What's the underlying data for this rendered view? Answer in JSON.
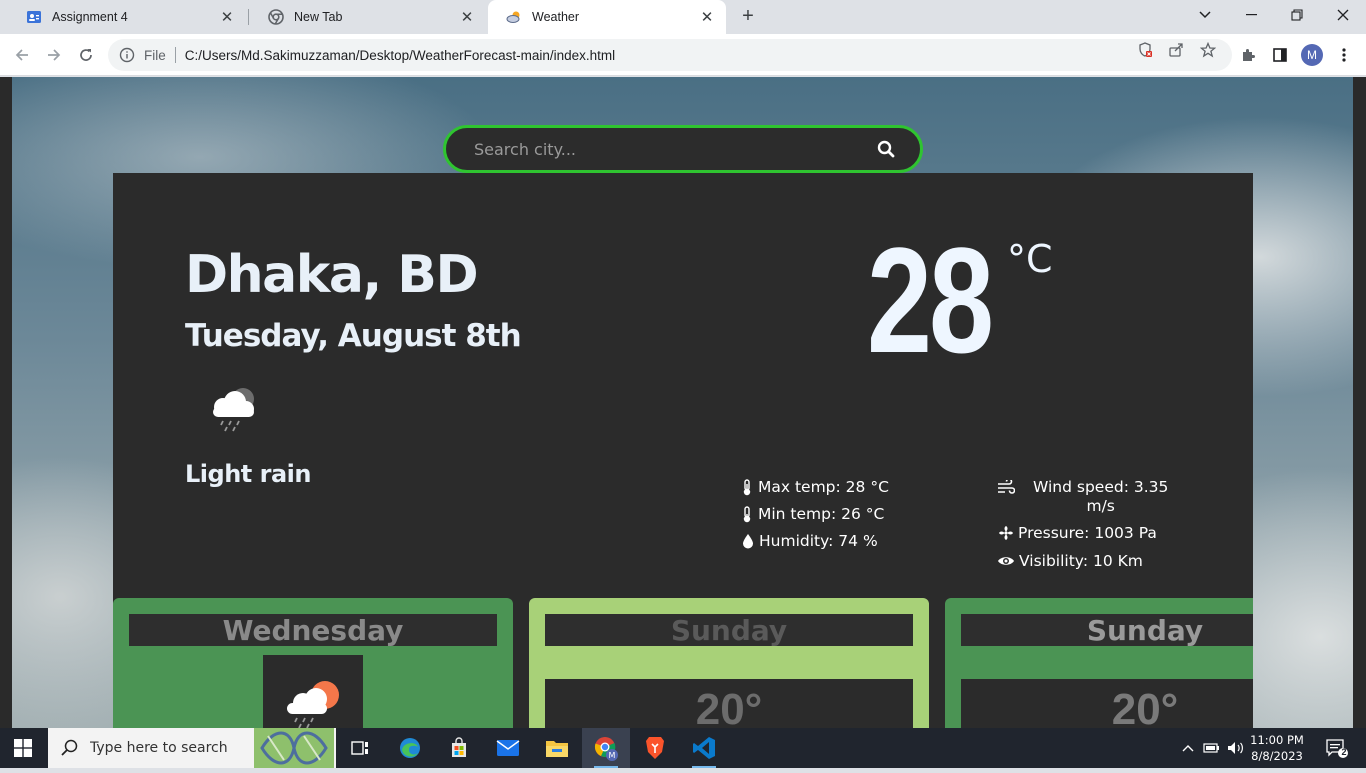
{
  "browser": {
    "tabs": [
      {
        "title": "Assignment 4",
        "icon": "person-doc-icon"
      },
      {
        "title": "New Tab",
        "icon": "chrome-icon"
      },
      {
        "title": "Weather",
        "icon": "weather-cloud-icon",
        "active": true
      }
    ],
    "address": {
      "scheme": "File",
      "url": "C:/Users/Md.Sakimuzzaman/Desktop/WeatherForecast-main/index.html"
    },
    "profile_initial": "M"
  },
  "page": {
    "search": {
      "placeholder": "Search city..."
    },
    "current": {
      "city": "Dhaka, BD",
      "date": "Tuesday, August 8th",
      "condition": "Light rain",
      "temperature": "28",
      "unit": "°C",
      "stats_left": [
        {
          "icon": "thermometer-icon",
          "text": "Max temp: 28 °C"
        },
        {
          "icon": "thermometer-icon",
          "text": "Min temp: 26 °C"
        },
        {
          "icon": "droplet-icon",
          "text": "Humidity: 74 %"
        }
      ],
      "stats_right": [
        {
          "icon": "wind-icon",
          "text_line1": "Wind speed: 3.35",
          "text_line2": "m/s"
        },
        {
          "icon": "fan-icon",
          "text": "Pressure: 1003 Pa"
        },
        {
          "icon": "eye-icon",
          "text": "Visibility: 10 Km"
        }
      ]
    },
    "forecast": [
      {
        "day": "Wednesday",
        "temp": "",
        "bg": "#4b9454"
      },
      {
        "day": "Sunday",
        "temp": "20°",
        "bg": "#a8d178"
      },
      {
        "day": "Sunday",
        "temp": "20°",
        "bg": "#4b9454"
      }
    ],
    "colors": {
      "search_border": "#2fc430",
      "card_bg": "#2b2b2b"
    }
  },
  "taskbar": {
    "search_placeholder": "Type here to search",
    "time": "11:00 PM",
    "date": "8/8/2023",
    "notification_count": "2"
  }
}
